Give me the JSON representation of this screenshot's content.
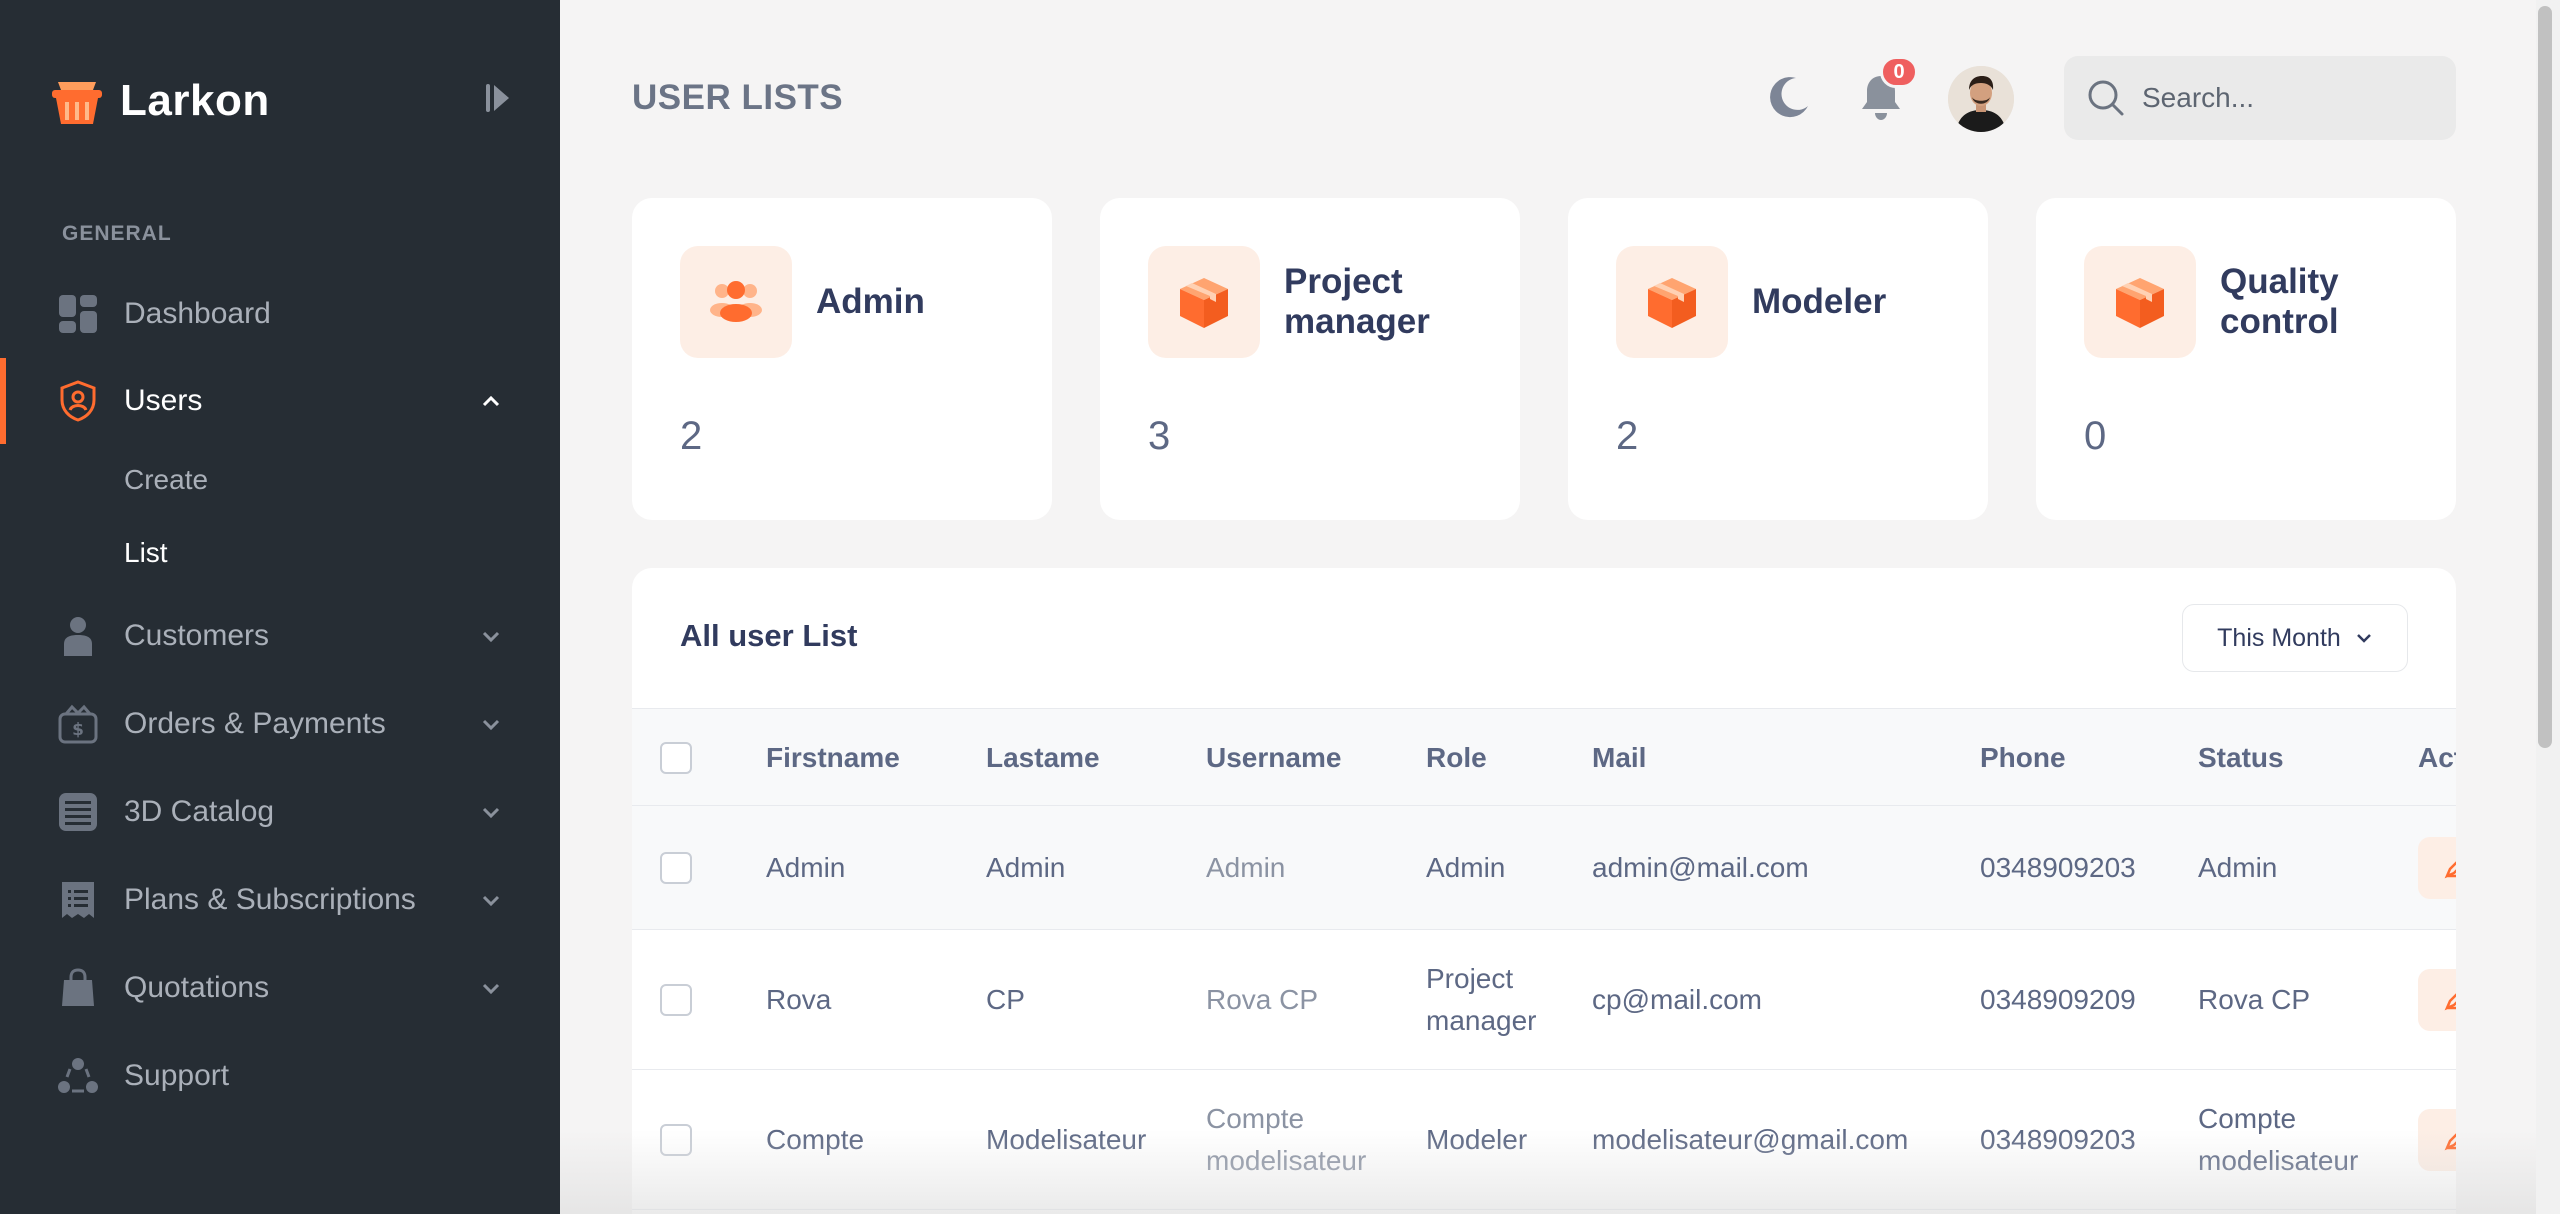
{
  "app": {
    "brand": "Larkon"
  },
  "sidebar": {
    "section_title": "GENERAL",
    "items": [
      {
        "label": "Dashboard",
        "icon": "dashboard-icon"
      },
      {
        "label": "Users",
        "icon": "shield-user-icon",
        "active": true
      },
      {
        "label": "Customers",
        "icon": "person-icon"
      },
      {
        "label": "Orders & Payments",
        "icon": "wallet-icon"
      },
      {
        "label": "3D Catalog",
        "icon": "catalog-icon"
      },
      {
        "label": "Plans & Subscriptions",
        "icon": "plans-icon"
      },
      {
        "label": "Quotations",
        "icon": "bag-icon"
      },
      {
        "label": "Support",
        "icon": "support-icon"
      }
    ],
    "users_sub": [
      "Create",
      "List"
    ]
  },
  "header": {
    "title": "USER LISTS",
    "notification_count": "0",
    "search_placeholder": "Search..."
  },
  "stats": [
    {
      "title": "Admin",
      "value": "2",
      "icon": "users-icon"
    },
    {
      "title": "Project manager",
      "value": "3",
      "icon": "box-icon"
    },
    {
      "title": "Modeler",
      "value": "2",
      "icon": "box-icon"
    },
    {
      "title": "Quality control",
      "value": "0",
      "icon": "box-icon"
    }
  ],
  "table": {
    "title": "All user List",
    "filter": "This Month",
    "columns": [
      "Firstname",
      "Lastame",
      "Username",
      "Role",
      "Mail",
      "Phone",
      "Status",
      "Act"
    ],
    "rows": [
      [
        "Admin",
        "Admin",
        "Admin",
        "Admin",
        "admin@mail.com",
        "0348909203",
        "Admin"
      ],
      [
        "Rova",
        "CP",
        "Rova CP",
        "Project manager",
        "cp@mail.com",
        "0348909209",
        "Rova CP"
      ],
      [
        "Compte",
        "Modelisateur",
        "Compte modelisateur",
        "Modeler",
        "modelisateur@gmail.com",
        "0348909203",
        "Compte modelisateur"
      ]
    ]
  },
  "colors": {
    "accent": "#ff6c2f",
    "sidebar": "#262d34",
    "badge": "#ef5f5f"
  }
}
